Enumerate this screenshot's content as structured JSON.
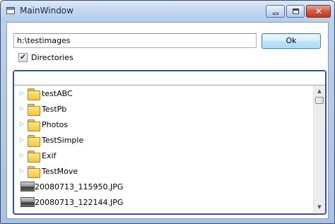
{
  "window": {
    "title": "MainWindow",
    "icons": {
      "app": "app-icon",
      "minimize": "minimize-icon",
      "maximize": "maximize-icon",
      "close": "close-icon"
    },
    "close_glyph": "✕"
  },
  "path_input": {
    "value": "h:\\testimages"
  },
  "ok_button": {
    "label": "Ok"
  },
  "directories_checkbox": {
    "label": "Directories",
    "checked": true
  },
  "tree": {
    "expander_glyph": "▷",
    "items": [
      {
        "label": "testABC",
        "icon": "folder-icon",
        "expandable": true
      },
      {
        "label": "TestPb",
        "icon": "folder-icon",
        "expandable": true
      },
      {
        "label": "Photos",
        "icon": "folder-icon",
        "expandable": true
      },
      {
        "label": "TestSimple",
        "icon": "folder-icon",
        "expandable": true
      },
      {
        "label": "Exif",
        "icon": "folder-icon",
        "expandable": true
      },
      {
        "label": "TestMove",
        "icon": "folder-icon",
        "expandable": true
      },
      {
        "label": "20080713_115950.JPG",
        "icon": "image-thumbnail-icon",
        "expandable": false
      },
      {
        "label": "20080713_122144.JPG",
        "icon": "image-thumbnail-icon",
        "expandable": false
      }
    ]
  },
  "scrollbar": {
    "up_glyph": "▲",
    "down_glyph": "▼"
  },
  "colors": {
    "panel_border": "#3355a8",
    "ok_button_border": "#3c7fb1",
    "folder": "#f2c93b"
  }
}
